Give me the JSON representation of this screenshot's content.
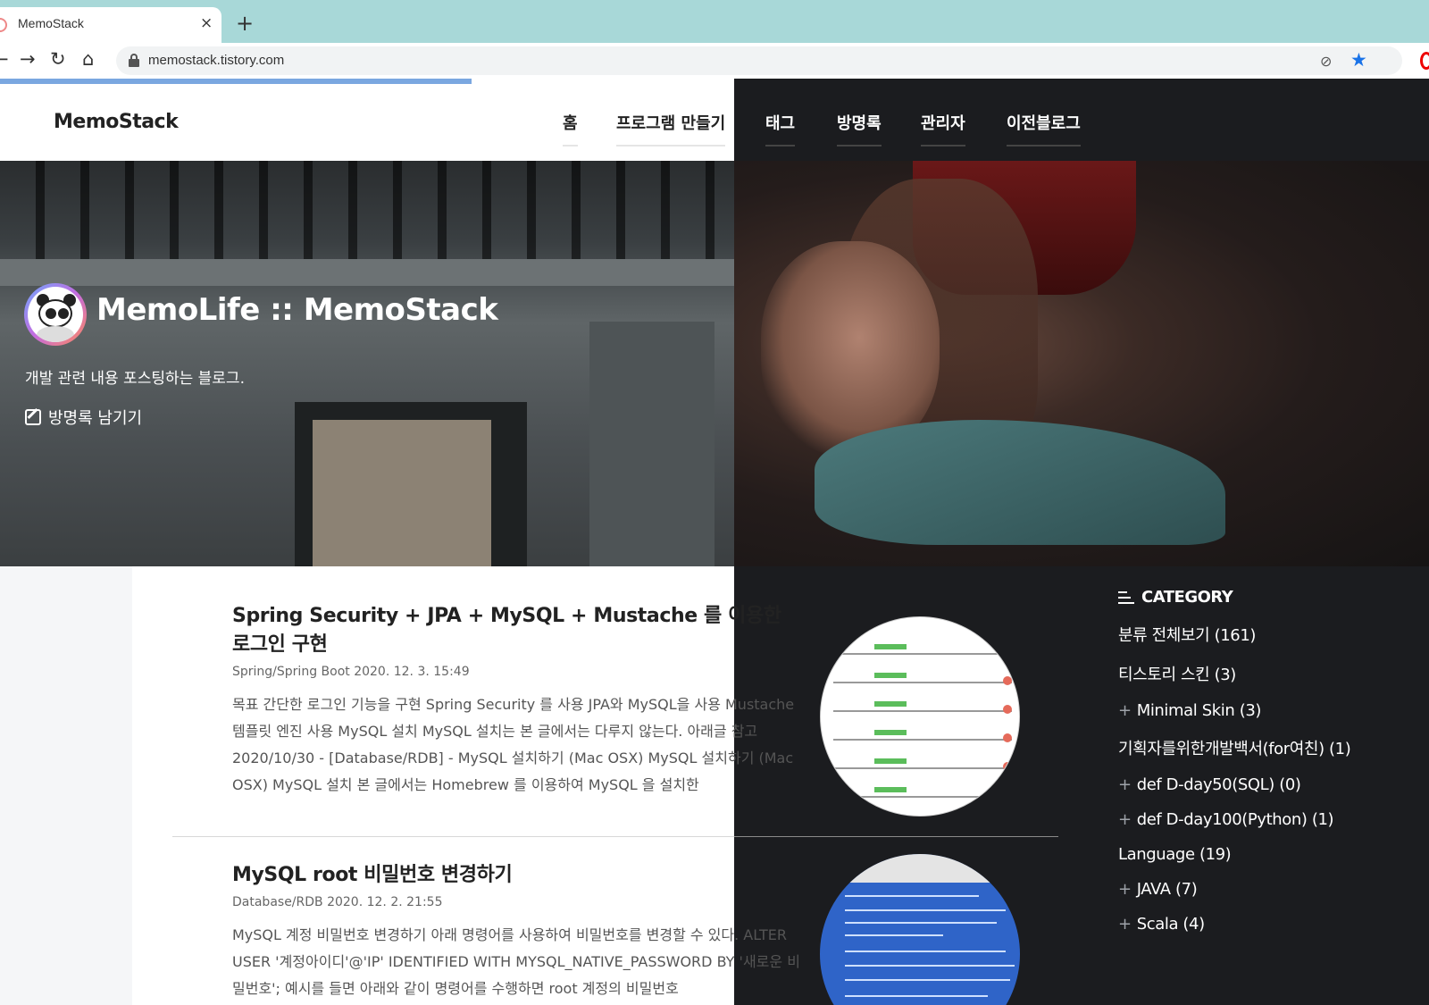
{
  "browser": {
    "tab_title": "MemoStack",
    "tab_close": "×",
    "new_tab": "+",
    "back": "←",
    "forward": "→",
    "reload": "↻",
    "home": "⌂",
    "url": "memostack.tistory.com",
    "bookmark_star": "★",
    "eye_off": "⊘",
    "load_progress": 0.33
  },
  "header": {
    "logo": "MemoStack",
    "menu": [
      "홈",
      "프로그램 만들기",
      "태그",
      "방명록",
      "관리자",
      "이전블로그"
    ]
  },
  "hero": {
    "title": "MemoLife :: MemoStack",
    "description": "개발 관련 내용 포스팅하는 블로그.",
    "guestbook_link": "방명록 남기기"
  },
  "posts": [
    {
      "title": "Spring Security + JPA + MySQL + Mustache 를 이용한 로그인 구현",
      "meta": "Spring/Spring Boot 2020. 12. 3. 15:49",
      "excerpt": "목표 간단한 로그인 기능을 구현 Spring Security 를 사용 JPA와 MySQL을 사용 Mustache 템플릿 엔진 사용 MySQL 설치 MySQL 설치는 본 글에서는 다루지 않는다. 아래글 참고 2020/10/30 - [Database/RDB] - MySQL 설치하기 (Mac OSX) MySQL 설치하기 (Mac OSX) MySQL 설치 본 글에서는 Homebrew 를 이용하여 MySQL 을 설치한"
    },
    {
      "title": "MySQL root 비밀번호 변경하기",
      "meta": "Database/RDB 2020. 12. 2. 21:55",
      "excerpt": "MySQL 계정 비밀번호 변경하기 아래 명령어를 사용하여 비밀번호를 변경할 수 있다. ALTER USER '계정아이디'@'IP' IDENTIFIED WITH MYSQL_NATIVE_PASSWORD BY '새로운 비밀번호'; 예시를 들면 아래와 같이 명령어를 수행하면 root 계정의 비밀번호"
    }
  ],
  "sidebar": {
    "heading": "CATEGORY",
    "items": [
      {
        "label": "분류 전체보기 (161)",
        "sub": false
      },
      {
        "label": "티스토리 스킨 (3)",
        "sub": false
      },
      {
        "label": "Minimal Skin (3)",
        "sub": true
      },
      {
        "label": "기획자를위한개발백서(for여친) (1)",
        "sub": false
      },
      {
        "label": "def D-day50(SQL) (0)",
        "sub": true
      },
      {
        "label": "def D-day100(Python) (1)",
        "sub": true
      },
      {
        "label": "Language (19)",
        "sub": false
      },
      {
        "label": "JAVA (7)",
        "sub": true
      },
      {
        "label": "Scala (4)",
        "sub": true
      }
    ],
    "plus_symbol": "+"
  },
  "colors": {
    "tabbar": "#a8d8d8",
    "dark_panel": "#1b1c1f",
    "progress": "#7aa7e0",
    "star": "#1a73e8"
  }
}
